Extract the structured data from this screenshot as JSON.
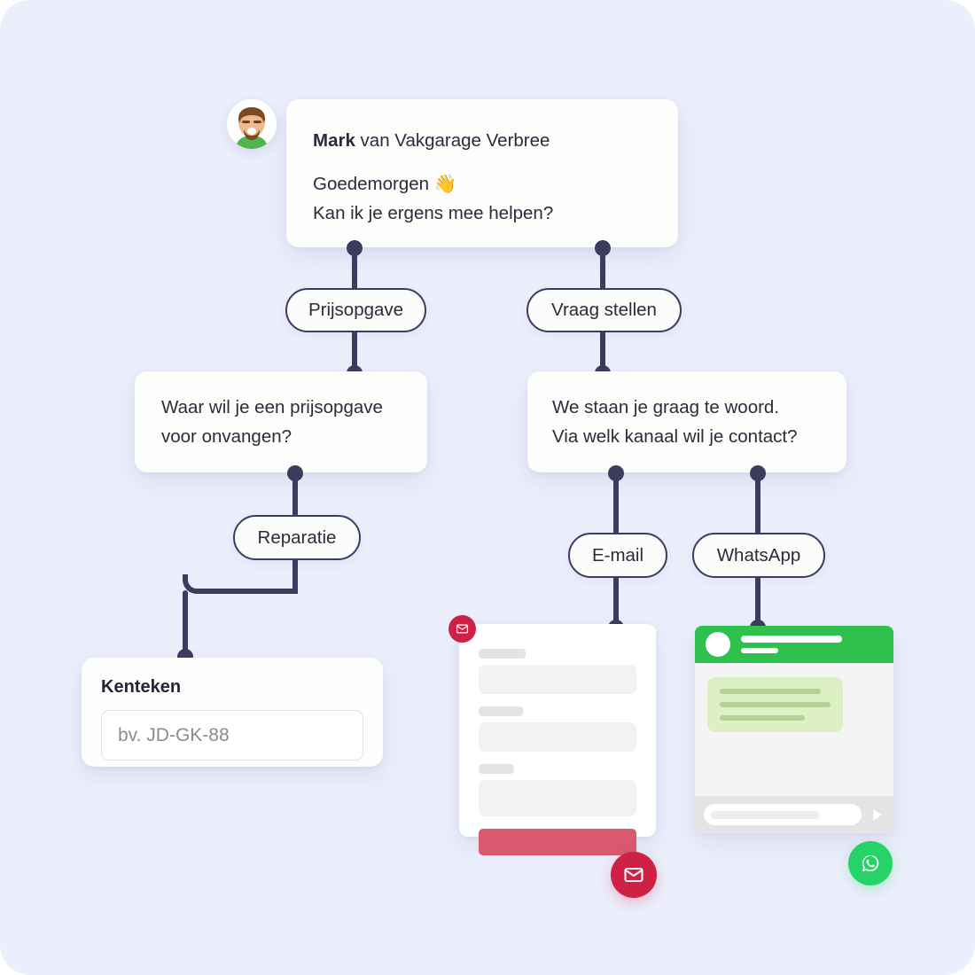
{
  "background": {
    "page": "#ebeefb",
    "card": "#fdfdfc",
    "connector": "#3c3c5e"
  },
  "colors": {
    "green": "#25b34c",
    "whatsapp_green": "#2ec14e",
    "email_red": "#cf2146",
    "pink_bar": "#d9596f",
    "bubble_green": "#dcf0c3"
  },
  "greeting_card": {
    "avatar_name": "agent-avatar",
    "sender_name": "Mark",
    "sender_rest": " van Vakgarage Verbree",
    "line1": "Goedemorgen",
    "line1_emoji": "👋",
    "line2": "Kan ik je ergens mee helpen?"
  },
  "options": {
    "prijsopgave": "Prijsopgave",
    "vraag_stellen": "Vraag stellen",
    "reparatie": "Reparatie",
    "email": "E-mail",
    "whatsapp": "WhatsApp"
  },
  "left_branch": {
    "question_line1": "Waar wil je een prijsopgave",
    "question_line2": "voor onvangen?",
    "form": {
      "label": "Kenteken",
      "placeholder": "bv. JD-GK-88",
      "value": "",
      "submit_icon": "chevron-right-icon"
    }
  },
  "right_branch": {
    "question_line1": "We staan je graag te woord.",
    "question_line2": "Via welk kanaal wil je contact?",
    "email_mock": {
      "badge_icon": "envelope-icon",
      "fields": 3,
      "submit_icon": "submit-bar"
    },
    "whatsapp_mock": {
      "badge_icon": "whatsapp-icon",
      "bubble_lines": 3,
      "send_icon": "send-triangle-icon"
    }
  },
  "channel_badges": {
    "email": "envelope-icon",
    "whatsapp": "whatsapp-icon"
  }
}
